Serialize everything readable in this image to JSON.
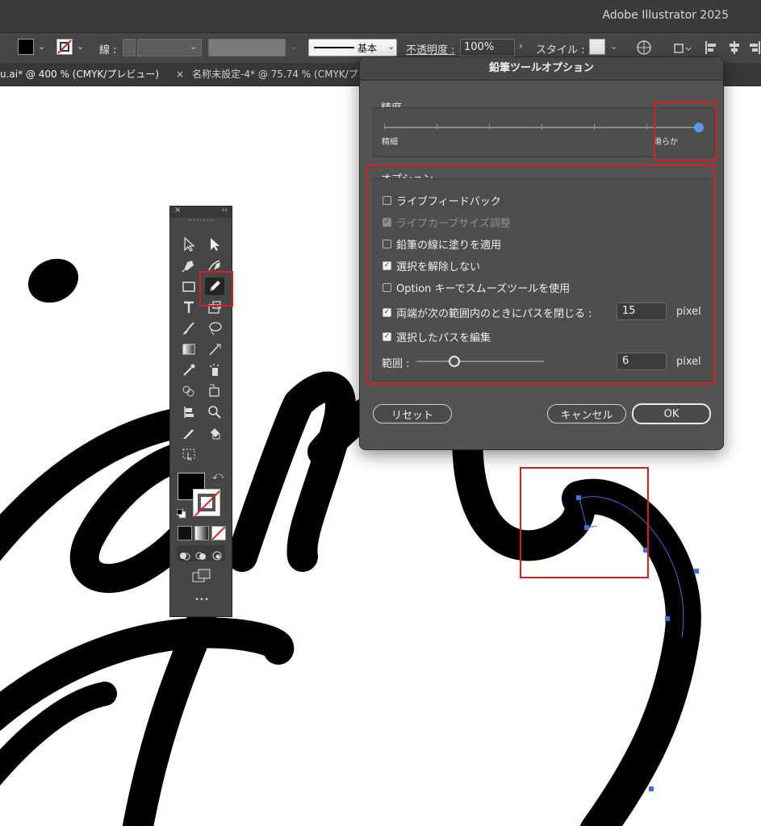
{
  "app": {
    "title": "Adobe Illustrator 2025"
  },
  "controlbar": {
    "stroke_label": "線 :",
    "brush_label": "基本",
    "opacity_label": "不透明度 :",
    "opacity_value": "100%",
    "style_label": "スタイル :"
  },
  "tabs": [
    {
      "label": "u.ai* @ 400 % (CMYK/プレビュー)",
      "active": true
    },
    {
      "label": "名称未設定-4* @ 75.74 % (CMYK/プ",
      "active": false
    }
  ],
  "tab_close_glyph": "×",
  "toolpanel": {
    "close_glyph": "×",
    "collapse_glyph": "‹‹",
    "more_glyph": "•••"
  },
  "dialog": {
    "title": "鉛筆ツールオプション",
    "precision": {
      "label": "精度",
      "min_label": "精細",
      "max_label": "滑らか",
      "value_fraction": 1.0
    },
    "options": {
      "label": "オプション",
      "items": [
        {
          "label": "ライブフィードバック",
          "checked": false,
          "disabled": false
        },
        {
          "label": "ライブカーブサイズ調整",
          "checked": true,
          "disabled": true
        },
        {
          "label": "鉛筆の線に塗りを適用",
          "checked": false,
          "disabled": false
        },
        {
          "label": "選択を解除しない",
          "checked": true,
          "disabled": false
        },
        {
          "label": "Option キーでスムーズツールを使用",
          "checked": false,
          "disabled": false
        },
        {
          "label": "両端が次の範囲内のときにパスを閉じる :",
          "checked": true,
          "disabled": false
        },
        {
          "label": "選択したパスを編集",
          "checked": true,
          "disabled": false
        }
      ],
      "close_value": "15",
      "close_unit": "pixel",
      "range_label": "範囲 :",
      "range_value": "6",
      "range_unit": "pixel",
      "range_fraction": 0.3
    },
    "buttons": {
      "reset": "リセット",
      "cancel": "キャンセル",
      "ok": "OK"
    }
  },
  "colors": {
    "highlight_red": "#d61f1f",
    "slider_blue": "#4a9df2",
    "path_blue": "#3f6fe0"
  }
}
